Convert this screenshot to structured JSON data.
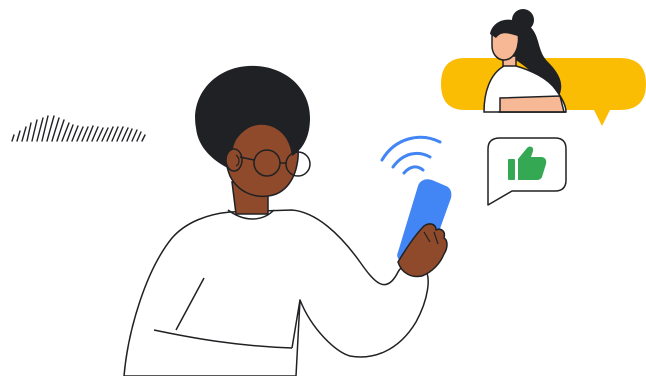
{
  "illustration": {
    "icons": {
      "wifi": "wifi-icon",
      "thumbs_up": "thumbs-up-icon",
      "speech_bubble": "speech-bubble-icon",
      "sound_wave": "sound-wave-icon"
    },
    "colors": {
      "skin_dark": "#8e4a2b",
      "skin_light": "#f7b995",
      "hair": "#202124",
      "shirt": "#ffffff",
      "outline": "#202124",
      "phone": "#4285f4",
      "wifi": "#4285f4",
      "thumbs_up": "#34a853",
      "banner": "#fbbc04",
      "background": "#ffffff"
    }
  }
}
